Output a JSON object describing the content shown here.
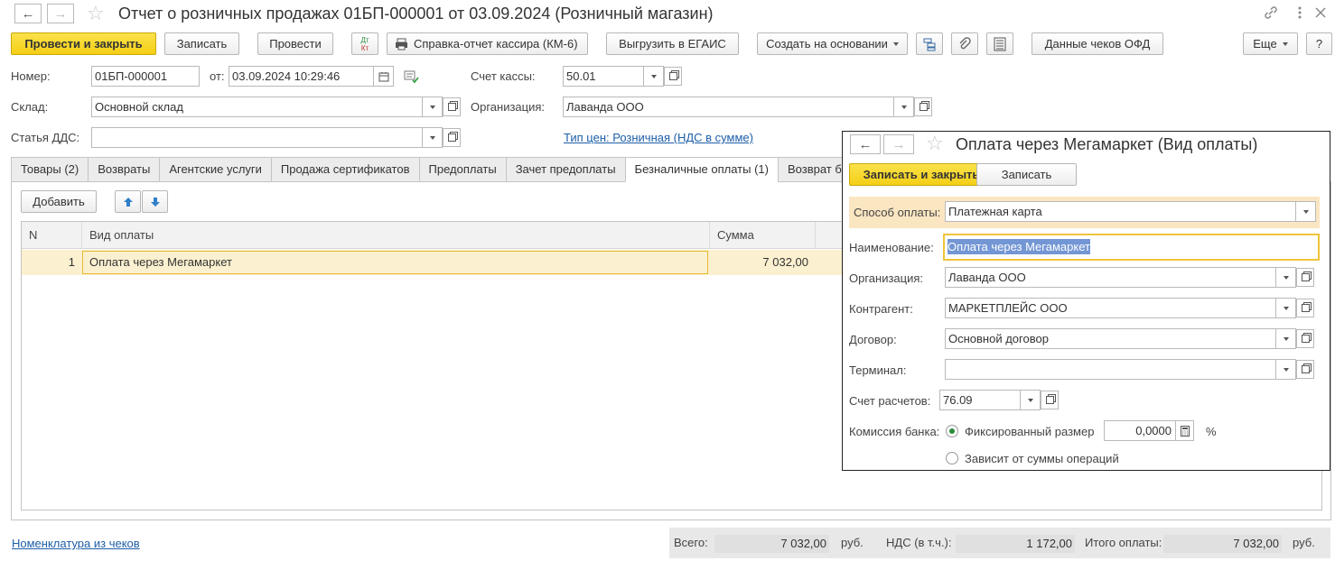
{
  "window": {
    "title": "Отчет о розничных продажах 01БП-000001 от 03.09.2024 (Розничный магазин)"
  },
  "toolbar": {
    "post_and_close": "Провести и закрыть",
    "save": "Записать",
    "post": "Провести",
    "dt_kt_top": "Дт",
    "dt_kt_bottom": "Кт",
    "cashier_report": "Справка-отчет кассира (КМ-6)",
    "egais": "Выгрузить в ЕГАИС",
    "create_based": "Создать на основании",
    "ofd": "Данные чеков ОФД",
    "more": "Еще",
    "help": "?"
  },
  "form": {
    "number_label": "Номер:",
    "number_value": "01БП-000001",
    "from_label": "от:",
    "date_value": "03.09.2024 10:29:46",
    "cash_account_label": "Счет кассы:",
    "cash_account_value": "50.01",
    "warehouse_label": "Склад:",
    "warehouse_value": "Основной склад",
    "organization_label": "Организация:",
    "organization_value": "Лаванда ООО",
    "dds_label": "Статья ДДС:",
    "dds_value": "",
    "price_type_link": "Тип цен: Розничная (НДС в сумме)"
  },
  "tabs": [
    {
      "label": "Товары (2)"
    },
    {
      "label": "Возвраты"
    },
    {
      "label": "Агентские услуги"
    },
    {
      "label": "Продажа сертификатов"
    },
    {
      "label": "Предоплаты"
    },
    {
      "label": "Зачет предоплаты"
    },
    {
      "label": "Безналичные оплаты (1)"
    },
    {
      "label": "Возврат без"
    }
  ],
  "table": {
    "add_button": "Добавить",
    "columns": [
      "N",
      "Вид оплаты",
      "Сумма"
    ],
    "rows": [
      {
        "n": "1",
        "payment_type": "Оплата через Мегамаркет",
        "amount": "7 032,00"
      }
    ]
  },
  "bottom": {
    "nomenclature_link": "Номенклатура из чеков",
    "total_label": "Всего:",
    "total_value": "7 032,00",
    "currency": "руб.",
    "vat_label": "НДС (в т.ч.):",
    "vat_value": "1 172,00",
    "grand_total_label": "Итого оплаты:",
    "grand_total_value": "7 032,00"
  },
  "dialog": {
    "title": "Оплата через Мегамаркет (Вид оплаты)",
    "save_and_close": "Записать и закрыть",
    "save": "Записать",
    "method_label": "Способ оплаты:",
    "method_value": "Платежная карта",
    "name_label": "Наименование:",
    "name_value": "Оплата через Мегамаркет",
    "org_label": "Организация:",
    "org_value": "Лаванда ООО",
    "counterparty_label": "Контрагент:",
    "counterparty_value": "МАРКЕТПЛЕЙС ООО",
    "contract_label": "Договор:",
    "contract_value": "Основной договор",
    "terminal_label": "Терминал:",
    "terminal_value": "",
    "settlement_label": "Счет расчетов:",
    "settlement_value": "76.09",
    "commission_label": "Комиссия банка:",
    "fixed_label": "Фиксированный размер",
    "fixed_value": "0,0000",
    "percent": "%",
    "depends_label": "Зависит от суммы операций"
  },
  "colors": {
    "primary_button": "#f4cf16",
    "link": "#1d5ea8",
    "selected_row": "#fbf0cf",
    "highlight_band": "#fbe6c2"
  }
}
